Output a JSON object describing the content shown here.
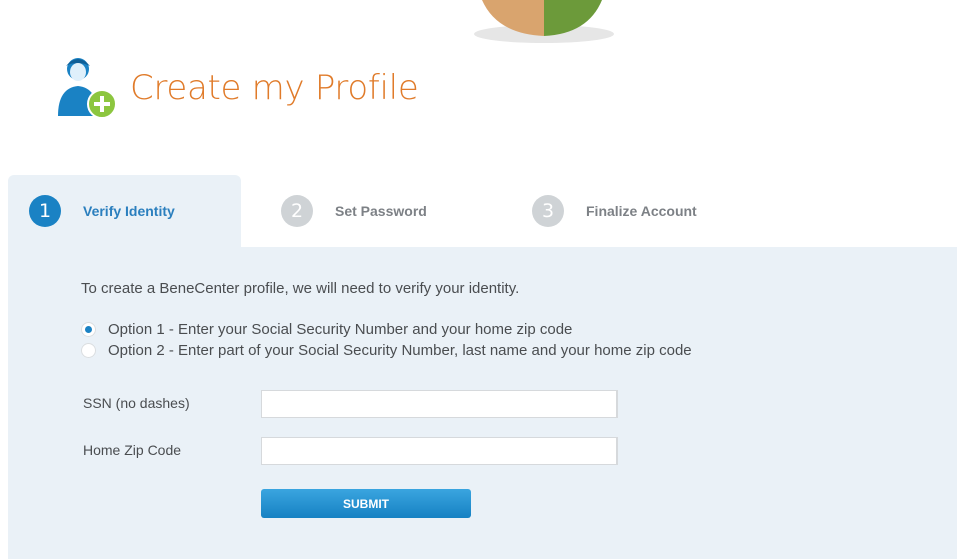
{
  "header": {
    "title": "Create my Profile",
    "icon": "user-add-icon"
  },
  "tabs": [
    {
      "number": "1",
      "label": "Verify Identity",
      "active": true
    },
    {
      "number": "2",
      "label": "Set Password",
      "active": false
    },
    {
      "number": "3",
      "label": "Finalize Account",
      "active": false
    }
  ],
  "form": {
    "intro": "To create a BeneCenter profile, we will need to verify your identity.",
    "options": [
      {
        "label": "Option 1 - Enter your Social Security Number and your home zip code",
        "selected": true
      },
      {
        "label": "Option 2 - Enter part of your Social Security Number, last name and your home zip code",
        "selected": false
      }
    ],
    "ssn_label": "SSN (no dashes)",
    "ssn_value": "",
    "zip_label": "Home Zip Code",
    "zip_value": "",
    "submit_label": "SUBMIT"
  },
  "colors": {
    "accent": "#1a82c4",
    "title": "#e07b2a",
    "panel": "#eaf1f7",
    "tab_inactive": "#cfd3d6"
  }
}
